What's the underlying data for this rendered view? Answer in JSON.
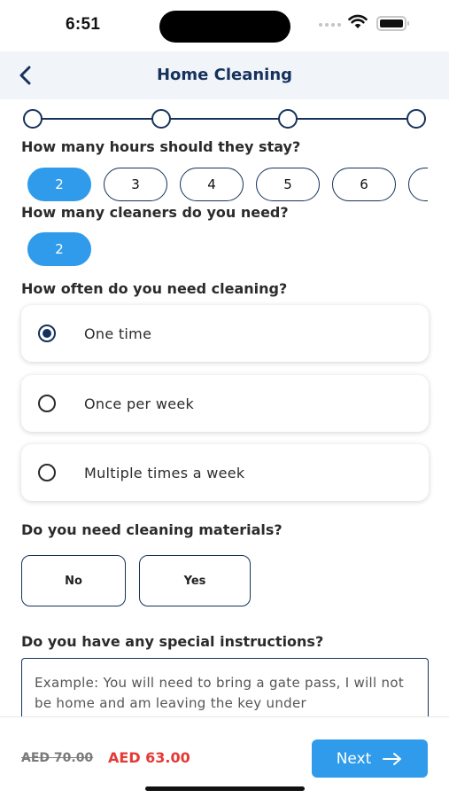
{
  "status_bar": {
    "time": "6:51"
  },
  "header": {
    "title": "Home Cleaning",
    "back_icon": "chevron-left-icon"
  },
  "stepper": {
    "steps": 4
  },
  "hours": {
    "question": "How many hours should they stay?",
    "options": [
      "2",
      "3",
      "4",
      "5",
      "6"
    ],
    "selected": "2"
  },
  "cleaners": {
    "question": "How many cleaners do you need?",
    "options": [
      "2"
    ],
    "selected": "2"
  },
  "frequency": {
    "question": "How often do you need cleaning?",
    "options": [
      {
        "label": "One time",
        "checked": true
      },
      {
        "label": "Once per week",
        "checked": false
      },
      {
        "label": "Multiple times a week",
        "checked": false
      }
    ]
  },
  "materials": {
    "question": "Do you need cleaning materials?",
    "no_label": "No",
    "yes_label": "Yes"
  },
  "instructions": {
    "question": "Do you have any special instructions?",
    "placeholder": "Example: You will need to bring a gate pass, I will not be home and am leaving the key under"
  },
  "footer": {
    "old_price": "AED 70.00",
    "new_price": "AED 63.00",
    "next_label": "Next",
    "next_icon": "arrow-right-icon"
  },
  "colors": {
    "primary_navy": "#16325c",
    "accent_blue": "#2f9bea",
    "price_red": "#e53935"
  }
}
